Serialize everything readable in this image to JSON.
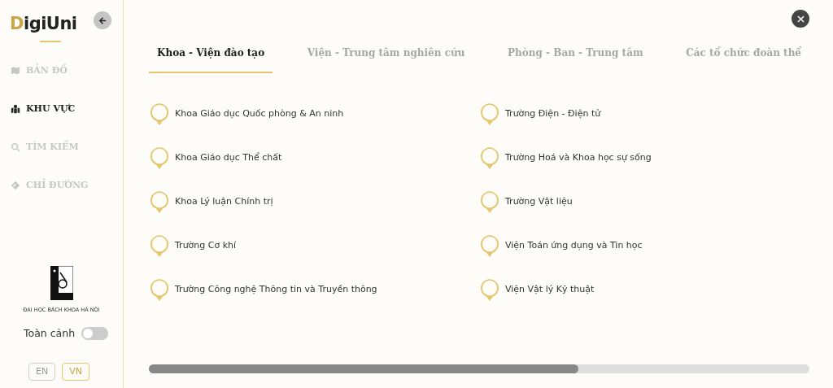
{
  "logo": {
    "text": "DigiUni"
  },
  "nav": [
    {
      "label": "BẢN ĐỒ",
      "selected": false
    },
    {
      "label": "KHU VỰC",
      "selected": true
    },
    {
      "label": "TÌM KIẾM",
      "selected": false
    },
    {
      "label": "CHỈ ĐƯỜNG",
      "selected": false
    }
  ],
  "university": {
    "caption": "ĐẠI HỌC BÁCH KHOA HÀ NỘI"
  },
  "panorama": {
    "label": "Toàn cảnh",
    "on": false
  },
  "languages": [
    {
      "label": "EN",
      "selected": false
    },
    {
      "label": "VN",
      "selected": true
    }
  ],
  "tabs": [
    {
      "label": "Khoa - Viện đào tạo",
      "selected": true
    },
    {
      "label": "Viện - Trung tâm nghiên cứu",
      "selected": false
    },
    {
      "label": "Phòng - Ban - Trung tâm",
      "selected": false
    },
    {
      "label": "Các tổ chức đoàn thể",
      "selected": false
    }
  ],
  "places": [
    "Khoa Giáo dục Quốc phòng & An ninh",
    "Trường Điện - Điện tử",
    "Khoa Giáo dục Thể chất",
    "Trường Hoá và Khoa học sự sống",
    "Khoa Lý luận Chính trị",
    "Trường Vật liệu",
    "Trường Cơ khí",
    "Viện Toán ứng dụng và Tin học",
    "Trường Công nghệ Thông tin và Truyền thông",
    "Viện Vật lý Kỹ thuật"
  ]
}
